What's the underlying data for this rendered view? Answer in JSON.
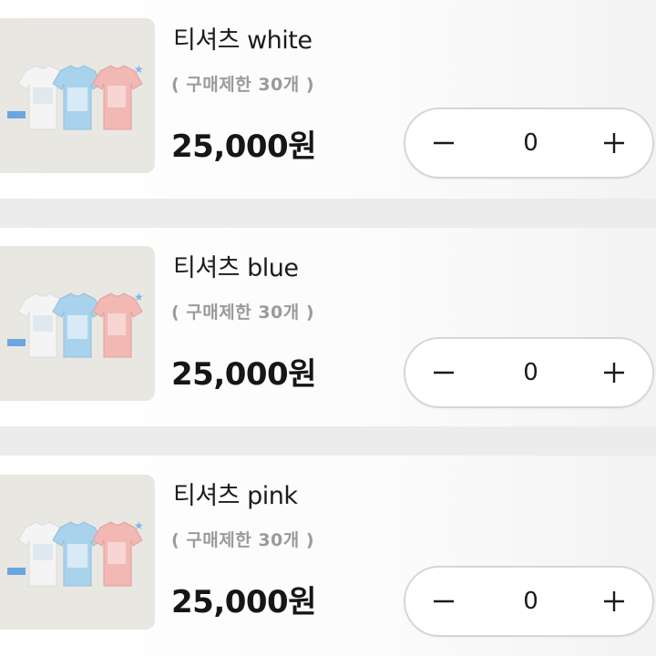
{
  "products": [
    {
      "title": "티셔츠 white",
      "limit": "( 구매제한 30개 )",
      "price": "25,000원",
      "quantity": "0",
      "thumbnail_icon": "tshirt-trio-image"
    },
    {
      "title": "티셔츠 blue",
      "limit": "( 구매제한 30개 )",
      "price": "25,000원",
      "quantity": "0",
      "thumbnail_icon": "tshirt-trio-image"
    },
    {
      "title": "티셔츠 pink",
      "limit": "( 구매제한 30개 )",
      "price": "25,000원",
      "quantity": "0",
      "thumbnail_icon": "tshirt-trio-image"
    }
  ],
  "stepper": {
    "minus_icon": "minus-icon",
    "plus_icon": "plus-icon"
  },
  "colors": {
    "shirt_white": "#f4f4f4",
    "shirt_blue": "#a9d3ec",
    "shirt_pink": "#f2b8b4",
    "thumb_bg": "#e9e7e2",
    "limit_text": "#9a9a9a",
    "star_blue": "#7fb8e6"
  }
}
